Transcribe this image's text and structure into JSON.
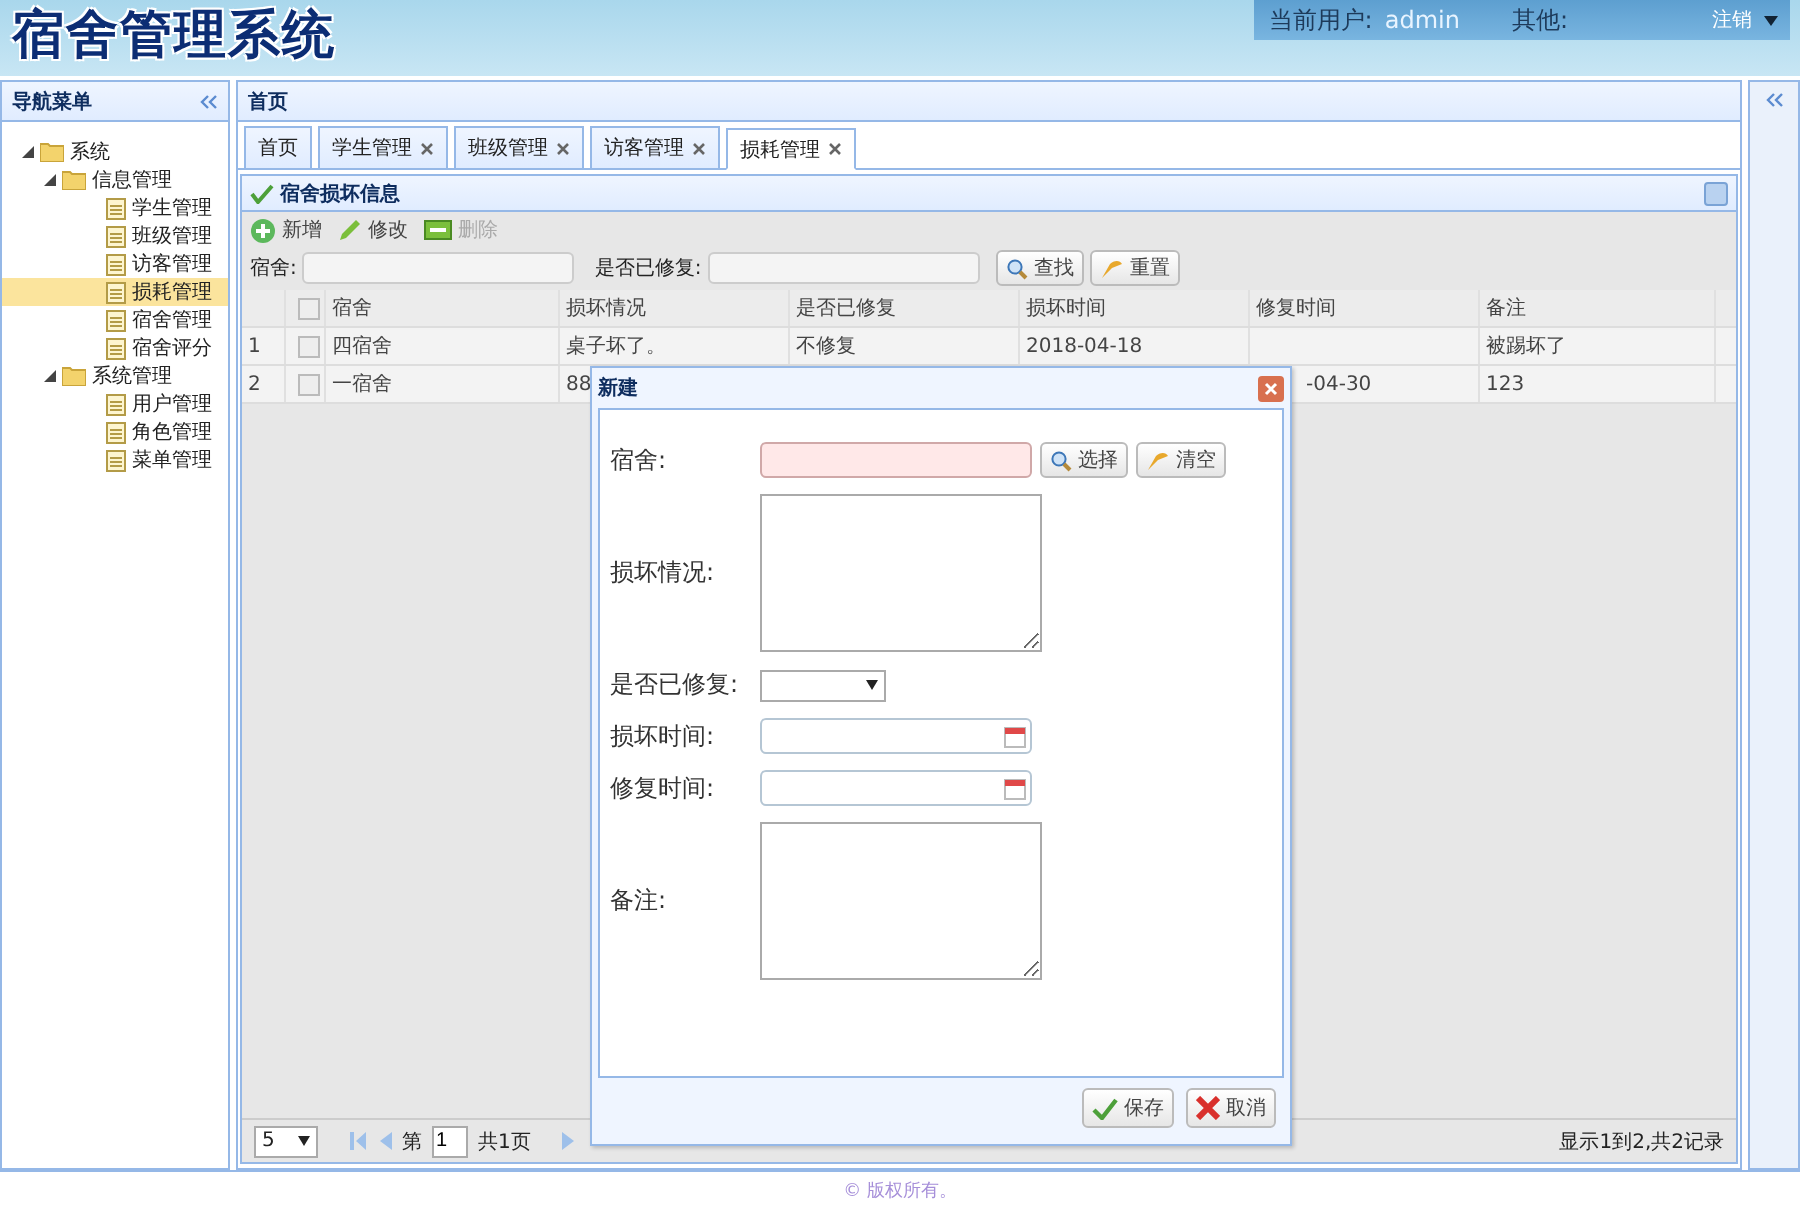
{
  "header": {
    "title": "宿舍管理系统",
    "user_label": "当前用户:",
    "user": "admin",
    "other_label": "其他:",
    "logout": "注销"
  },
  "sidebar": {
    "title": "导航菜单",
    "tree": [
      {
        "label": "系统",
        "expanded": true,
        "children": [
          {
            "label": "信息管理",
            "expanded": true,
            "children": [
              {
                "label": "学生管理",
                "selected": false
              },
              {
                "label": "班级管理",
                "selected": false
              },
              {
                "label": "访客管理",
                "selected": false
              },
              {
                "label": "损耗管理",
                "selected": true
              },
              {
                "label": "宿舍管理",
                "selected": false
              },
              {
                "label": "宿舍评分",
                "selected": false
              }
            ]
          },
          {
            "label": "系统管理",
            "expanded": true,
            "children": [
              {
                "label": "用户管理",
                "selected": false
              },
              {
                "label": "角色管理",
                "selected": false
              },
              {
                "label": "菜单管理",
                "selected": false
              }
            ]
          }
        ]
      }
    ]
  },
  "center": {
    "title": "首页",
    "tabs": [
      {
        "label": "首页",
        "closable": false,
        "selected": false
      },
      {
        "label": "学生管理",
        "closable": true,
        "selected": false
      },
      {
        "label": "班级管理",
        "closable": true,
        "selected": false
      },
      {
        "label": "访客管理",
        "closable": true,
        "selected": false
      },
      {
        "label": "损耗管理",
        "closable": true,
        "selected": true
      }
    ]
  },
  "panel": {
    "title": "宿舍损坏信息",
    "toolbar": [
      {
        "kind": "add",
        "label": "新增",
        "disabled": false
      },
      {
        "kind": "edit",
        "label": "修改",
        "disabled": false
      },
      {
        "kind": "delete",
        "label": "删除",
        "disabled": true
      }
    ],
    "search": {
      "dorm_label": "宿舍:",
      "repaired_label": "是否已修复:",
      "find": "查找",
      "reset": "重置"
    },
    "table": {
      "columns": [
        "宿舍",
        "损坏情况",
        "是否已修复",
        "损坏时间",
        "修复时间",
        "备注"
      ],
      "all_checked": false,
      "rows": [
        {
          "num": "1",
          "checked": false,
          "cells": [
            "四宿舍",
            "桌子坏了。",
            "不修复",
            "2018-04-18",
            null,
            "被踢坏了"
          ]
        },
        {
          "num": "2",
          "checked": false,
          "cells": [
            "一宿舍",
            "88",
            null,
            null,
            {
              "text": "-04-30",
              "cut_left": true
            },
            "123"
          ]
        }
      ]
    },
    "pager": {
      "size": "5",
      "page_label": "第",
      "page": "1",
      "total_pages": "共1页",
      "summary": "显示1到2,共2记录"
    }
  },
  "dialog": {
    "title": "新建",
    "fields": [
      {
        "kind": "text",
        "label": "宿舍:",
        "required": true,
        "select": "选择",
        "clear": "清空"
      },
      {
        "kind": "textarea",
        "label": "损坏情况:"
      },
      {
        "kind": "select",
        "label": "是否已修复:"
      },
      {
        "kind": "date",
        "label": "损坏时间:"
      },
      {
        "kind": "date",
        "label": "修复时间:"
      },
      {
        "kind": "textarea",
        "label": "备注:"
      }
    ],
    "save": "保存",
    "cancel": "取消"
  },
  "footer": "© 版权所有。"
}
